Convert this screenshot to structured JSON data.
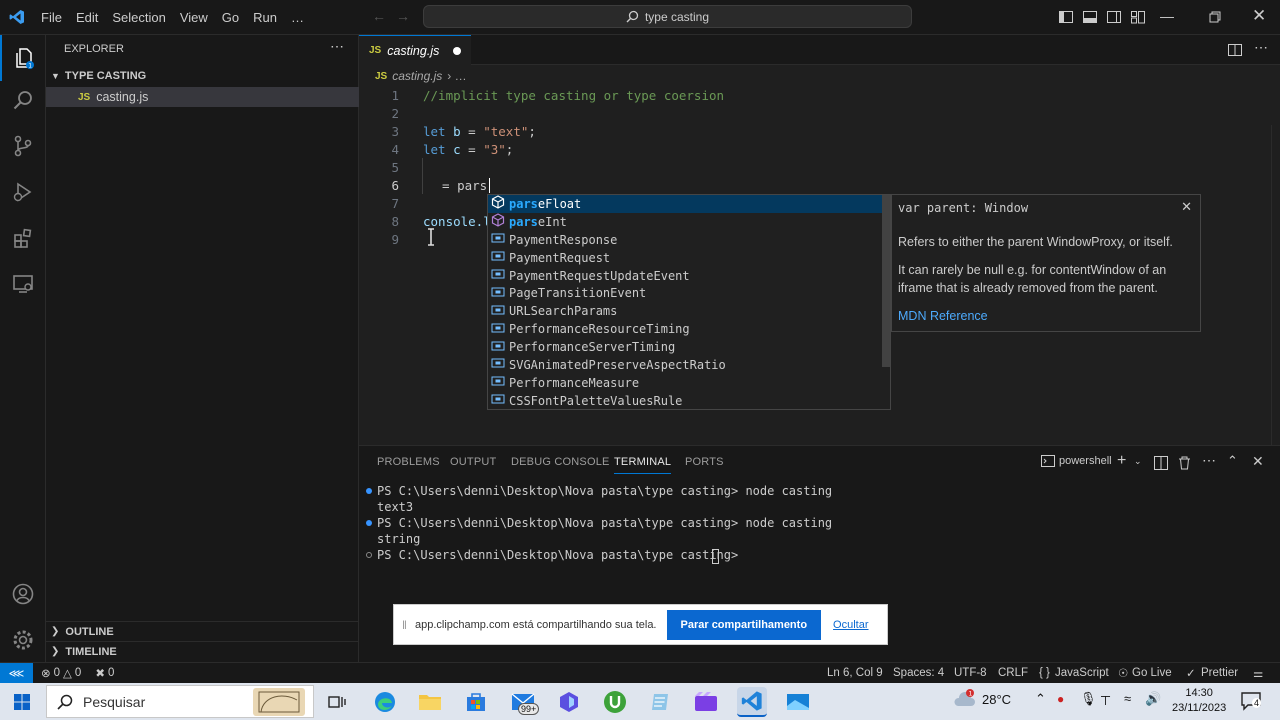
{
  "menu": [
    "File",
    "Edit",
    "Selection",
    "View",
    "Go",
    "Run",
    "…"
  ],
  "command_center": {
    "label": "type casting"
  },
  "sidebar": {
    "title": "EXPLORER",
    "folder": "TYPE CASTING",
    "file": "casting.js",
    "outline": "OUTLINE",
    "timeline": "TIMELINE"
  },
  "editor": {
    "tab": {
      "label": "casting.js",
      "badge": "JS"
    },
    "breadcrumb": {
      "badge": "JS",
      "file": "casting.js",
      "rest": "› …"
    },
    "lines": [
      {
        "n": "1",
        "text": "//implicit type casting or type coersion"
      },
      {
        "n": "2",
        "text": ""
      },
      {
        "n": "3",
        "text": "let b = \"text\";"
      },
      {
        "n": "4",
        "text": "let c = \"3\";"
      },
      {
        "n": "5",
        "text": ""
      },
      {
        "n": "6",
        "text": " = pars"
      },
      {
        "n": "7",
        "text": ""
      },
      {
        "n": "8",
        "text": "console.l"
      },
      {
        "n": "9",
        "text": ""
      }
    ]
  },
  "suggestions": [
    {
      "pre": "",
      "hl": "pars",
      "post": "eFloat",
      "label": "parseFloat"
    },
    {
      "pre": "",
      "hl": "pars",
      "post": "eInt",
      "label": "parseInt"
    },
    {
      "label": "PaymentResponse"
    },
    {
      "label": "PaymentRequest"
    },
    {
      "label": "PaymentRequestUpdateEvent"
    },
    {
      "label": "PageTransitionEvent"
    },
    {
      "label": "URLSearchParams"
    },
    {
      "label": "PerformanceResourceTiming"
    },
    {
      "label": "PerformanceServerTiming"
    },
    {
      "label": "SVGAnimatedPreserveAspectRatio"
    },
    {
      "label": "PerformanceMeasure"
    },
    {
      "label": "CSSFontPaletteValuesRule"
    }
  ],
  "details": {
    "signature": "var parent: Window",
    "p1": "Refers to either the parent WindowProxy, or itself.",
    "p2": "It can rarely be null e.g. for contentWindow of an iframe that is already removed from the parent.",
    "link": "MDN Reference"
  },
  "panel": {
    "tabs": [
      "PROBLEMS",
      "OUTPUT",
      "DEBUG CONSOLE",
      "TERMINAL",
      "PORTS"
    ],
    "active_tab": "TERMINAL",
    "shell": "powershell",
    "lines": [
      "PS C:\\Users\\denni\\Desktop\\Nova pasta\\type casting> node casting",
      "text3",
      "PS C:\\Users\\denni\\Desktop\\Nova pasta\\type casting> node casting",
      "string",
      "PS C:\\Users\\denni\\Desktop\\Nova pasta\\type casting> "
    ]
  },
  "share": {
    "message": "app.clipchamp.com está compartilhando sua tela.",
    "stop": "Parar compartilhamento",
    "hide": "Ocultar"
  },
  "status": {
    "errors": "0",
    "warnings": "0",
    "ports": "0",
    "position": "Ln 6, Col 9",
    "spaces": "Spaces: 4",
    "encoding": "UTF-8",
    "eol": "CRLF",
    "language": "JavaScript",
    "golive": "Go Live",
    "prettier": "Prettier"
  },
  "taskbar": {
    "search": "Pesquisar",
    "weather": "28°C",
    "time": "14:30",
    "date": "23/11/2023",
    "mail_badge": "99+",
    "notif": "4"
  },
  "colors": {
    "accent": "#0078d4",
    "keyword": "#569cd6",
    "string": "#ce9178",
    "comment": "#6a9955",
    "variable": "#9cdcfe"
  }
}
